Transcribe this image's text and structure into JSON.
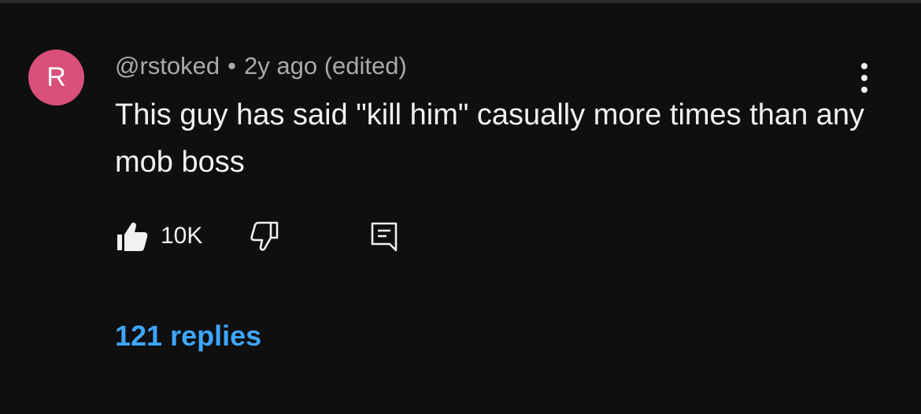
{
  "comment": {
    "avatar_initial": "R",
    "avatar_color": "#d9507a",
    "author": "@rstoked",
    "separator": "•",
    "timestamp": "2y ago (edited)",
    "text": "This guy has said \"kill him\" casually more times than any mob boss",
    "like_count": "10K",
    "replies_label": "121 replies",
    "accent_color": "#3ea6ff"
  },
  "icons": {
    "menu": "more-vertical-icon",
    "like": "thumbs-up-filled-icon",
    "dislike": "thumbs-down-outline-icon",
    "reply": "comment-reply-icon"
  }
}
